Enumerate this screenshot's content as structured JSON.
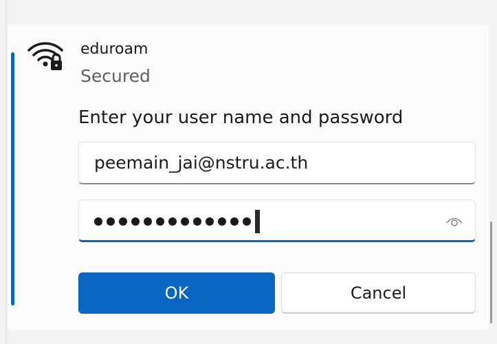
{
  "network": {
    "name": "eduroam",
    "status": "Secured",
    "icon": "wifi-lock-icon"
  },
  "form": {
    "prompt": "Enter your user name and password",
    "username_value": "peemain_jai@nstru.ac.th",
    "password_mask_count": 13,
    "reveal_icon": "eye-icon"
  },
  "buttons": {
    "ok_label": "OK",
    "cancel_label": "Cancel"
  },
  "colors": {
    "accent": "#0a64c2",
    "background": "#f3f3f3",
    "card": "#fbfbfb"
  }
}
